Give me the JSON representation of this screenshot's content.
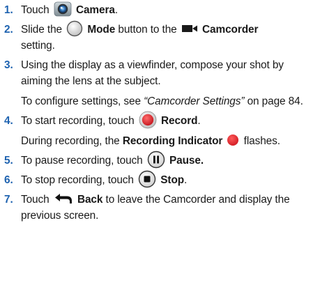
{
  "steps": [
    {
      "number": "1.",
      "pre": "Touch",
      "icon": "camera-app-icon",
      "bold": "Camera",
      "post": "."
    },
    {
      "number": "2.",
      "pre": "Slide the",
      "icon": "mode-slider-icon",
      "bold": "Mode",
      "mid": "button to the",
      "icon2": "camcorder-icon",
      "bold2": "Camcorder",
      "post": "setting."
    },
    {
      "number": "3.",
      "text": "Using the display as a viewfinder, compose your shot by aiming the lens at the subject.",
      "sub_pre": "To configure settings, see",
      "sub_ref": "“Camcorder Settings”",
      "sub_post": "on page 84."
    },
    {
      "number": "4.",
      "pre": "To start recording, touch",
      "icon": "record-button-icon",
      "bold": "Record",
      "post": ".",
      "sub_pre": "During recording, the",
      "sub_bold": "Recording Indicator",
      "sub_icon": "recording-indicator-icon",
      "sub_post": "flashes."
    },
    {
      "number": "5.",
      "pre": "To pause recording, touch",
      "icon": "pause-button-icon",
      "bold": "Pause."
    },
    {
      "number": "6.",
      "pre": "To stop recording, touch",
      "icon": "stop-button-icon",
      "bold": "Stop",
      "post": "."
    },
    {
      "number": "7.",
      "pre": "Touch",
      "icon": "back-arrow-icon",
      "bold": "Back",
      "post": "to leave the Camcorder and display the previous screen."
    }
  ],
  "colors": {
    "step_number": "#1f63b0",
    "record_red": "#e0232b",
    "icon_gray": "#555555"
  }
}
